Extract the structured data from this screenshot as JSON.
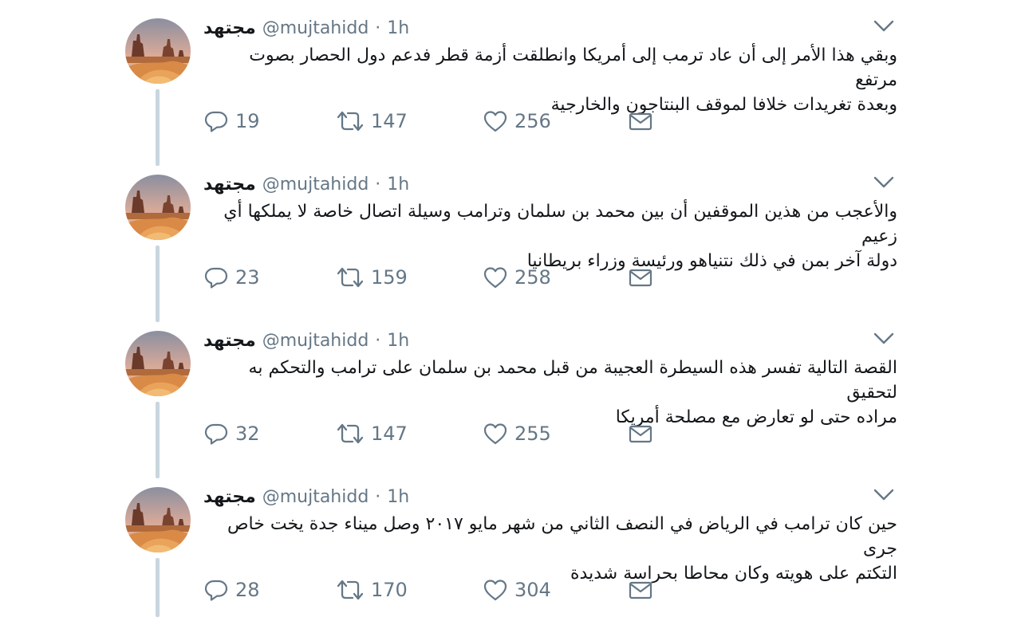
{
  "tweets": [
    {
      "name": "مجتهد",
      "handle": "@mujtahidd",
      "separator": "·",
      "time": "1h",
      "text_line1": "وبقي هذا الأمر إلى أن عاد ترمب إلى أمريكا وانطلقت أزمة قطر فدعم دول الحصار بصوت مرتفع",
      "text_line2": "وبعدة تغريدات خلافا لموقف البنتاجون والخارجية",
      "replies": "19",
      "retweets": "147",
      "likes": "256"
    },
    {
      "name": "مجتهد",
      "handle": "@mujtahidd",
      "separator": "·",
      "time": "1h",
      "text_line1": "والأعجب من هذين الموقفين أن بين محمد بن سلمان وترامب وسيلة اتصال خاصة لا يملكها أي زعيم",
      "text_line2": "دولة آخر بمن في ذلك نتنياهو ورئيسة وزراء بريطانيا",
      "replies": "23",
      "retweets": "159",
      "likes": "258"
    },
    {
      "name": "مجتهد",
      "handle": "@mujtahidd",
      "separator": "·",
      "time": "1h",
      "text_line1": "القصة التالية تفسر هذه السيطرة العجيبة من قبل محمد بن سلمان على ترامب والتحكم به لتحقيق",
      "text_line2": "مراده حتى لو تعارض مع مصلحة أمريكا",
      "replies": "32",
      "retweets": "147",
      "likes": "255"
    },
    {
      "name": "مجتهد",
      "handle": "@mujtahidd",
      "separator": "·",
      "time": "1h",
      "text_line1": "حين كان ترامب في الرياض في النصف الثاني من شهر مايو ٢٠١٧ وصل ميناء جدة يخت خاص جرى",
      "text_line2": "التكتم على هويته وكان محاطا بحراسة شديدة",
      "replies": "28",
      "retweets": "170",
      "likes": "304"
    }
  ],
  "icons": {
    "reply": "reply-icon",
    "retweet": "retweet-icon",
    "like": "heart-icon",
    "dm": "envelope-icon",
    "caret": "chevron-down-icon"
  },
  "colors": {
    "text": "#14171a",
    "secondary": "#657786",
    "thread_line": "#c9d6df"
  }
}
